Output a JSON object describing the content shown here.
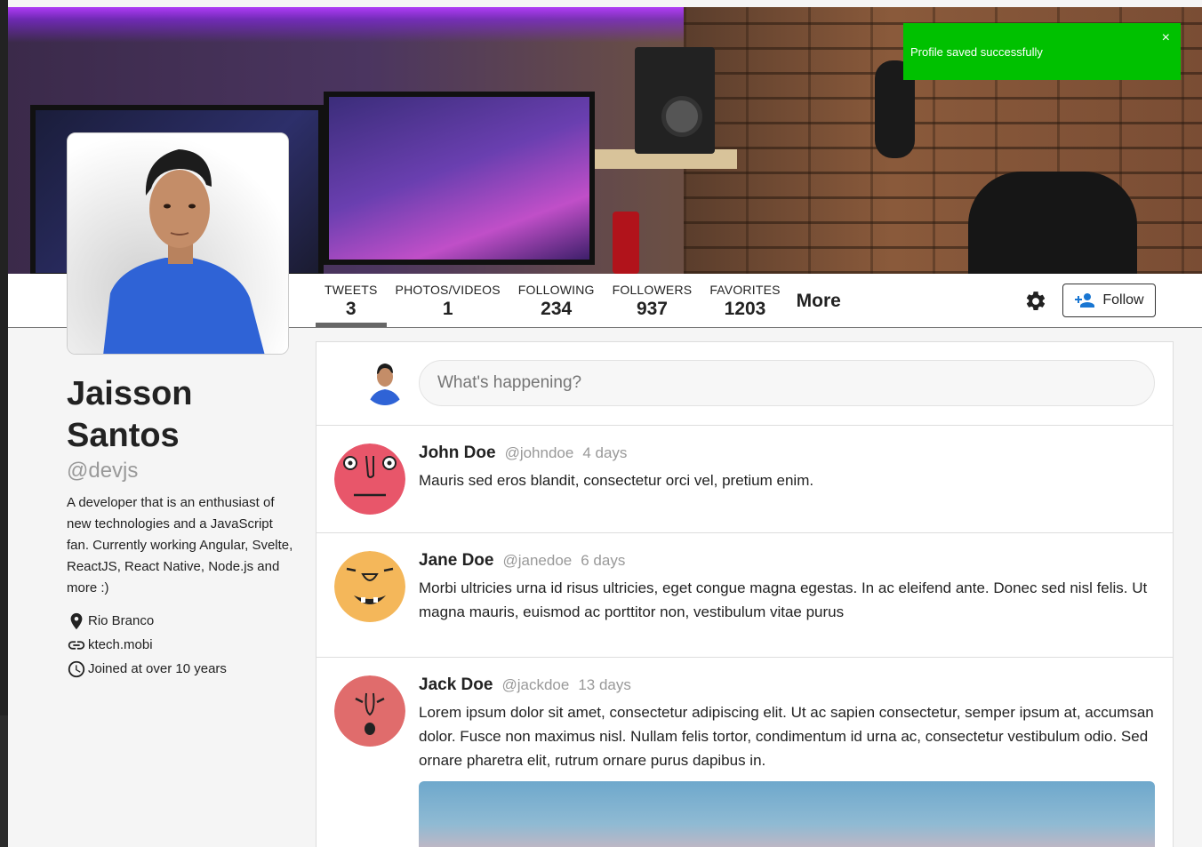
{
  "toast": {
    "message": "Profile saved successfully",
    "close": "×"
  },
  "tabs": [
    {
      "label": "TWEETS",
      "count": "3"
    },
    {
      "label": "PHOTOS/VIDEOS",
      "count": "1"
    },
    {
      "label": "FOLLOWING",
      "count": "234"
    },
    {
      "label": "FOLLOWERS",
      "count": "937"
    },
    {
      "label": "FAVORITES",
      "count": "1203"
    }
  ],
  "more_label": "More",
  "follow_label": "Follow",
  "profile": {
    "name": "Jaisson Santos",
    "handle": "@devjs",
    "bio": "A developer that is an enthusiast of new technologies and a JavaScript fan. Currently working Angular, Svelte, ReactJS, React Native, Node.js and more :)",
    "location": "Rio Branco",
    "website": "ktech.mobi",
    "joined": "Joined at over 10 years"
  },
  "compose": {
    "placeholder": "What's happening?"
  },
  "tweets": [
    {
      "name": "John Doe",
      "handle": "@johndoe",
      "time": "4 days",
      "text": "Mauris sed eros blandit, consectetur orci vel, pretium enim.",
      "avatar_color": "#e8566a"
    },
    {
      "name": "Jane Doe",
      "handle": "@janedoe",
      "time": "6 days",
      "text": "Morbi ultricies urna id risus ultricies, eget congue magna egestas. In ac eleifend ante. Donec sed nisl felis. Ut magna mauris, euismod ac porttitor non, vestibulum vitae purus",
      "avatar_color": "#f4b75a"
    },
    {
      "name": "Jack Doe",
      "handle": "@jackdoe",
      "time": "13 days",
      "text": "Lorem ipsum dolor sit amet, consectetur adipiscing elit. Ut ac sapien consectetur, semper ipsum at, accumsan dolor. Fusce non maximus nisl. Nullam felis tortor, condimentum id urna ac, consectetur vestibulum odio. Sed ornare pharetra elit, rutrum ornare purus dapibus in.",
      "avatar_color": "#e06c6c"
    }
  ],
  "colors": {
    "toast": "#00c100",
    "accent_icon": "#1976d2"
  }
}
